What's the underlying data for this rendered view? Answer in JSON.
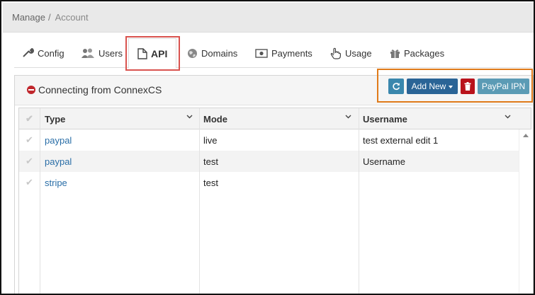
{
  "breadcrumb": {
    "root": "Manage",
    "separator": "/",
    "current": "Account"
  },
  "tabs": [
    {
      "label": "Config",
      "icon": "wrench-icon"
    },
    {
      "label": "Users",
      "icon": "users-icon"
    },
    {
      "label": "API",
      "icon": "file-icon",
      "active": true
    },
    {
      "label": "Domains",
      "icon": "globe-icon"
    },
    {
      "label": "Payments",
      "icon": "money-icon"
    },
    {
      "label": "Usage",
      "icon": "hand-pointer-icon"
    },
    {
      "label": "Packages",
      "icon": "gift-icon"
    }
  ],
  "panel": {
    "title": "Connecting from ConnexCS",
    "status_icon": "minus-circle-icon"
  },
  "toolbar": {
    "refresh_icon": "refresh-icon",
    "add_new_label": "Add New",
    "delete_icon": "trash-icon",
    "paypal_ipn_label": "PayPal IPN"
  },
  "grid": {
    "columns": [
      "Type",
      "Mode",
      "Username"
    ],
    "rows": [
      {
        "type": "paypal",
        "mode": "live",
        "username": "test external edit 1"
      },
      {
        "type": "paypal",
        "mode": "test",
        "username": "Username"
      },
      {
        "type": "stripe",
        "mode": "test",
        "username": ""
      }
    ]
  },
  "colors": {
    "highlight_red": "#d9534f",
    "highlight_orange": "#e07b1a",
    "add_button": "#2a6496",
    "delete_button": "#b9121b",
    "ipn_button": "#5b9bb5",
    "link": "#2a6ea7"
  }
}
